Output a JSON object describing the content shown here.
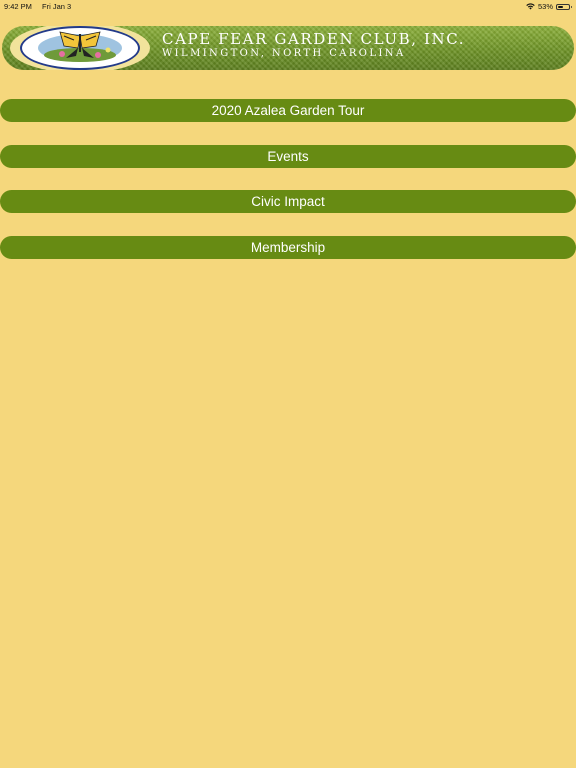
{
  "status_bar": {
    "time": "9:42 PM",
    "date": "Fri Jan 3",
    "battery_percent": "53%",
    "battery_level": 0.53,
    "wifi_icon": "wifi-icon",
    "battery_icon": "battery-icon"
  },
  "banner": {
    "title": "Cape Fear Garden Club, Inc.",
    "subtitle": "Wilmington, North Carolina",
    "logo_icon": "butterfly-logo",
    "colors": {
      "banner_green": "#6e9426",
      "logo_ring": "#233b8a"
    }
  },
  "menu": {
    "items": [
      {
        "label": "2020 Azalea Garden Tour"
      },
      {
        "label": "Events"
      },
      {
        "label": "Civic Impact"
      },
      {
        "label": "Membership"
      }
    ]
  },
  "colors": {
    "background": "#f5d77c",
    "button": "#678b13",
    "button_text": "#ffffff"
  }
}
